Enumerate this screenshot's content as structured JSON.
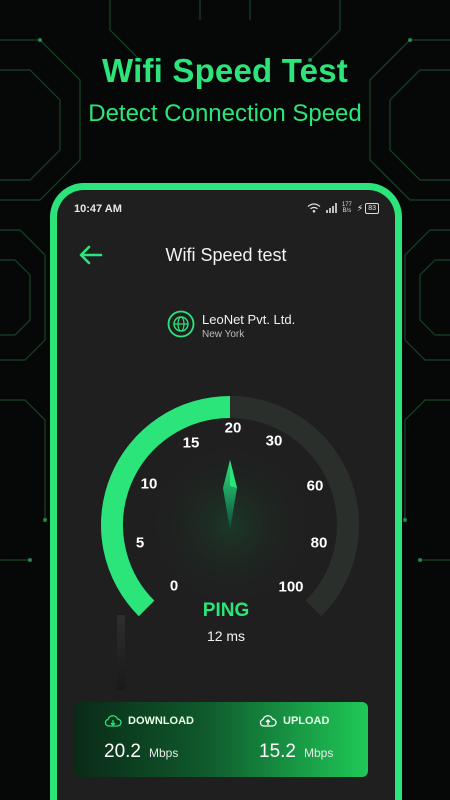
{
  "promo": {
    "title": "Wifi Speed Test",
    "subtitle": "Detect Connection Speed"
  },
  "colors": {
    "accent": "#2BE57A",
    "panel": "#1F1F1F",
    "background": "#060807"
  },
  "status_bar": {
    "time": "10:47 AM",
    "net_speed_value": "177",
    "net_speed_unit": "B/s",
    "battery": "83"
  },
  "app_bar": {
    "back_icon": "arrow-left-icon",
    "title": "Wifi Speed test"
  },
  "isp": {
    "icon": "globe-icon",
    "name": "LeoNet Pvt. Ltd.",
    "location": "New York"
  },
  "gauge": {
    "scale": [
      "0",
      "5",
      "10",
      "15",
      "20",
      "30",
      "60",
      "80",
      "100"
    ],
    "progress_fraction": 0.5
  },
  "ping": {
    "label": "PING",
    "value": "12 ms"
  },
  "results": {
    "download": {
      "icon": "cloud-download-icon",
      "label": "DOWNLOAD",
      "value": "20.2",
      "unit": "Mbps"
    },
    "upload": {
      "icon": "cloud-upload-icon",
      "label": "UPLOAD",
      "value": "15.2",
      "unit": "Mbps"
    }
  }
}
